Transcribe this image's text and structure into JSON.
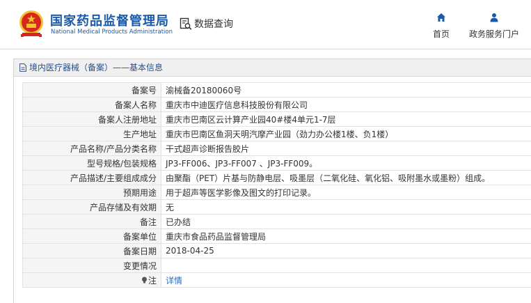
{
  "header": {
    "logo_cn": "国家药品监督管理局",
    "logo_en": "National Medical Products Administration",
    "query_label": "数据查询",
    "nav": [
      {
        "label": "首页",
        "icon": "home-icon"
      },
      {
        "label": "政务服务门户",
        "icon": "user-icon"
      }
    ]
  },
  "colors": {
    "brand_blue": "#1a5aa8",
    "link_blue": "#2a6cc7",
    "emblem_red": "#d7261e",
    "emblem_gold": "#f2c12e"
  },
  "panel": {
    "title": "境内医疗器械（备案）——基本信息"
  },
  "rows": [
    {
      "label": "备案号",
      "value": "渝械备20180060号"
    },
    {
      "label": "备案人名称",
      "value": "重庆市中迪医疗信息科技股份有限公司"
    },
    {
      "label": "备案人注册地址",
      "value": "重庆市巴南区云计算产业园40#楼4单元1-7层"
    },
    {
      "label": "生产地址",
      "value": "重庆市巴南区鱼洞天明汽摩产业园（劲力办公楼1楼、负1楼）"
    },
    {
      "label": "产品名称/产品分类名称",
      "value": "干式超声诊断报告胶片"
    },
    {
      "label": "型号规格/包装规格",
      "value": "JP3-FF006、JP3-FF007 、JP3-FF009。"
    },
    {
      "label": "产品描述/主要组成成分",
      "value": "由聚酯（PET）片基与防静电层、吸墨层（二氧化硅、氧化铝、吸附墨水或墨粉）组成。"
    },
    {
      "label": "预期用途",
      "value": "用于超声等医学影像及图文的打印记录。"
    },
    {
      "label": "产品存储及有效期",
      "value": "无"
    },
    {
      "label": "备注",
      "value": "已办结"
    },
    {
      "label": "备案单位",
      "value": "重庆市食品药品监督管理局"
    },
    {
      "label": "备案日期",
      "value": "2018-04-25"
    },
    {
      "label": "变更情况",
      "value": ""
    },
    {
      "label": "注",
      "value": "详情",
      "icon": "lightbulb-icon"
    }
  ]
}
